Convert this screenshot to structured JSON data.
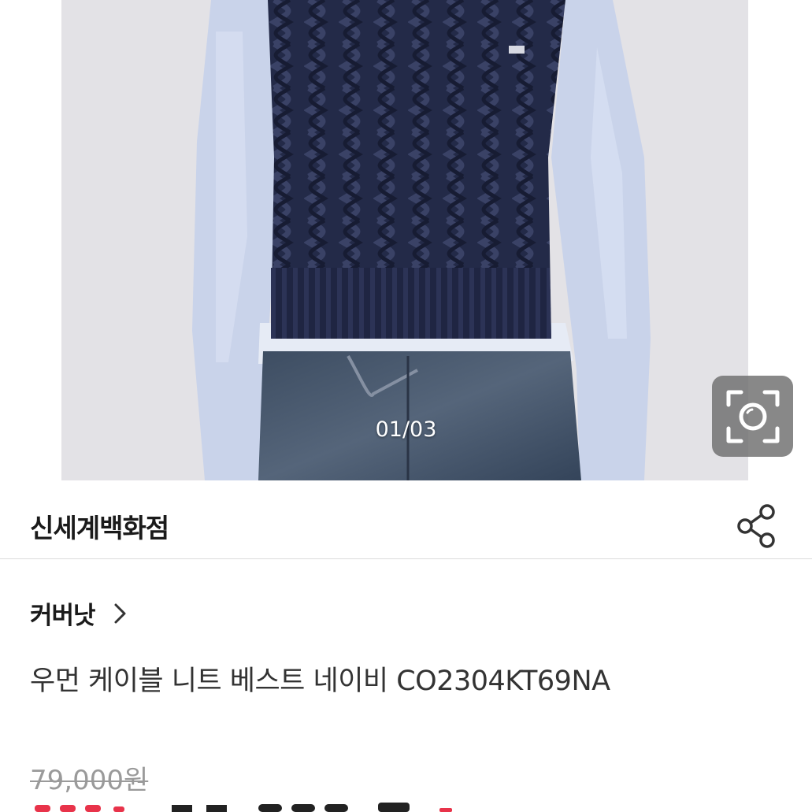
{
  "gallery": {
    "counter": "01/03",
    "lens_icon": "image-search-icon"
  },
  "seller": {
    "name": "신세계백화점",
    "share_icon": "share-icon"
  },
  "brand": {
    "name": "커버낫",
    "chevron_icon": "chevron-right-icon"
  },
  "product": {
    "title": "우먼 케이블 니트 베스트 네이비 CO2304KT69NA",
    "original_price": "79,000원"
  },
  "colors": {
    "accent_sale": "#e8334a",
    "text_primary": "#1a1a1a",
    "text_muted": "#9a9a9a"
  }
}
